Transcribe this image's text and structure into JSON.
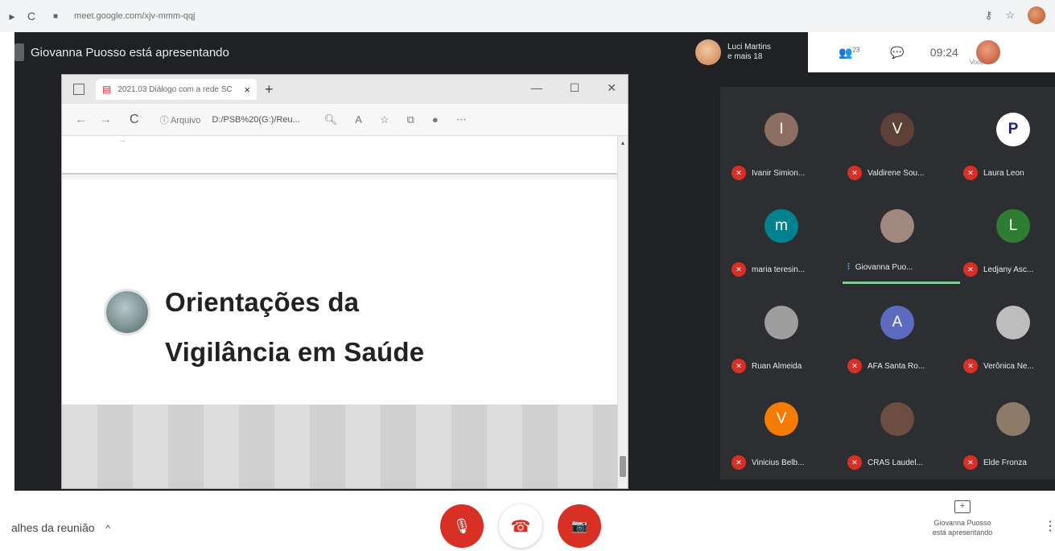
{
  "browser": {
    "nav_back": "▸",
    "reload": "C",
    "lock": "■",
    "url": "meet.google.com/xjv-mmm-qqj",
    "icons": [
      "key-icon",
      "star-icon",
      "profile-avatar"
    ]
  },
  "meet": {
    "presenter_banner": "Giovanna Puosso está apresentando",
    "caption_name": "Luci Martins",
    "caption_sub": "e mais 18",
    "participants_icon": "👥",
    "participants_count": "23",
    "chat_icon": "💬",
    "time": "09:24",
    "you_label": "Você"
  },
  "shared_window": {
    "tab_title": "2021.03 Diálogo com a rede SC",
    "tab_close": "×",
    "new_tab": "+",
    "win_min": "—",
    "win_max": "☐",
    "win_close": "✕",
    "reload": "C",
    "info": "ⓘ Arquivo",
    "path": "D:/PSB%20(G:)/Reu...",
    "page_snippet": "...",
    "heading": "Orientações da\nVigilância em Saúde"
  },
  "participants": [
    {
      "name": "Ivanir Simion...",
      "initial": "I",
      "color": "#8d6e63",
      "speaking": false
    },
    {
      "name": "Valdirene Sou...",
      "initial": "V",
      "color": "#5d4037",
      "speaking": false
    },
    {
      "name": "Laura Leon",
      "initial": "P",
      "color": "#ffffff",
      "speaking": false
    },
    {
      "name": "maria teresin...",
      "initial": "m",
      "color": "#00838f",
      "speaking": false
    },
    {
      "name": "Giovanna Puo...",
      "initial": "",
      "color": "#a1887f",
      "speaking": true
    },
    {
      "name": "Ledjany Asc...",
      "initial": "L",
      "color": "#2e7d32",
      "speaking": false
    },
    {
      "name": "Ruan Almeida",
      "initial": "",
      "color": "#9e9e9e",
      "speaking": false
    },
    {
      "name": "AFA Santa Ro...",
      "initial": "A",
      "color": "#5c6bc0",
      "speaking": false
    },
    {
      "name": "Verônica Ne...",
      "initial": "",
      "color": "#bdbdbd",
      "speaking": false
    },
    {
      "name": "Vinicius Belb...",
      "initial": "V",
      "color": "#f57c00",
      "speaking": false
    },
    {
      "name": "CRAS Laudel...",
      "initial": "",
      "color": "#6d4c41",
      "speaking": false
    },
    {
      "name": "Elde Fronza",
      "initial": "",
      "color": "#8d7b6a",
      "speaking": false
    }
  ],
  "bottom": {
    "details": "alhes da reunião",
    "details_chev": "^",
    "mic": "🎙",
    "hangup": "☎",
    "camera": "📷",
    "present_icon": "+",
    "present_line1": "Giovanna Puosso",
    "present_line2": "está apresentando",
    "more": "⋮"
  }
}
